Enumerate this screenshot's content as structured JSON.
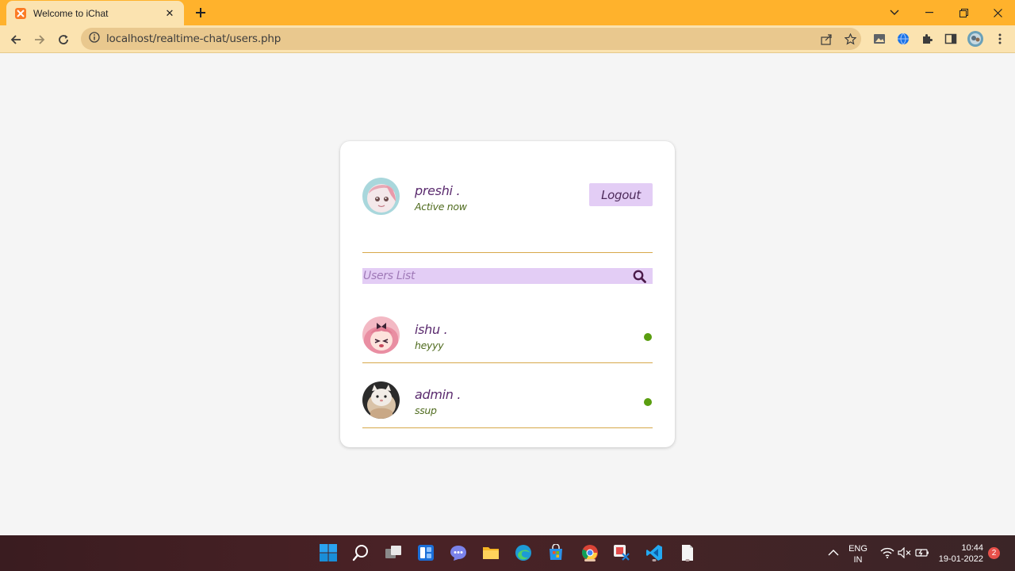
{
  "browser": {
    "tab_title": "Welcome to iChat",
    "url": "localhost/realtime-chat/users.php"
  },
  "chat": {
    "current_user": {
      "name": "preshi .",
      "status": "Active now"
    },
    "logout_label": "Logout",
    "search_placeholder": "Users List",
    "users": [
      {
        "name": "ishu .",
        "last_message": "heyyy",
        "online": true
      },
      {
        "name": "admin .",
        "last_message": "ssup",
        "online": true
      }
    ],
    "colors": {
      "accent_purple": "#e3cdf5",
      "divider_gold": "#d7a84a",
      "online_green": "#5a9e10",
      "title_bar": "#ffb22c"
    }
  },
  "taskbar": {
    "language": "ENG",
    "region": "IN",
    "time": "10:44",
    "date": "19-01-2022",
    "notification_count": "2"
  }
}
